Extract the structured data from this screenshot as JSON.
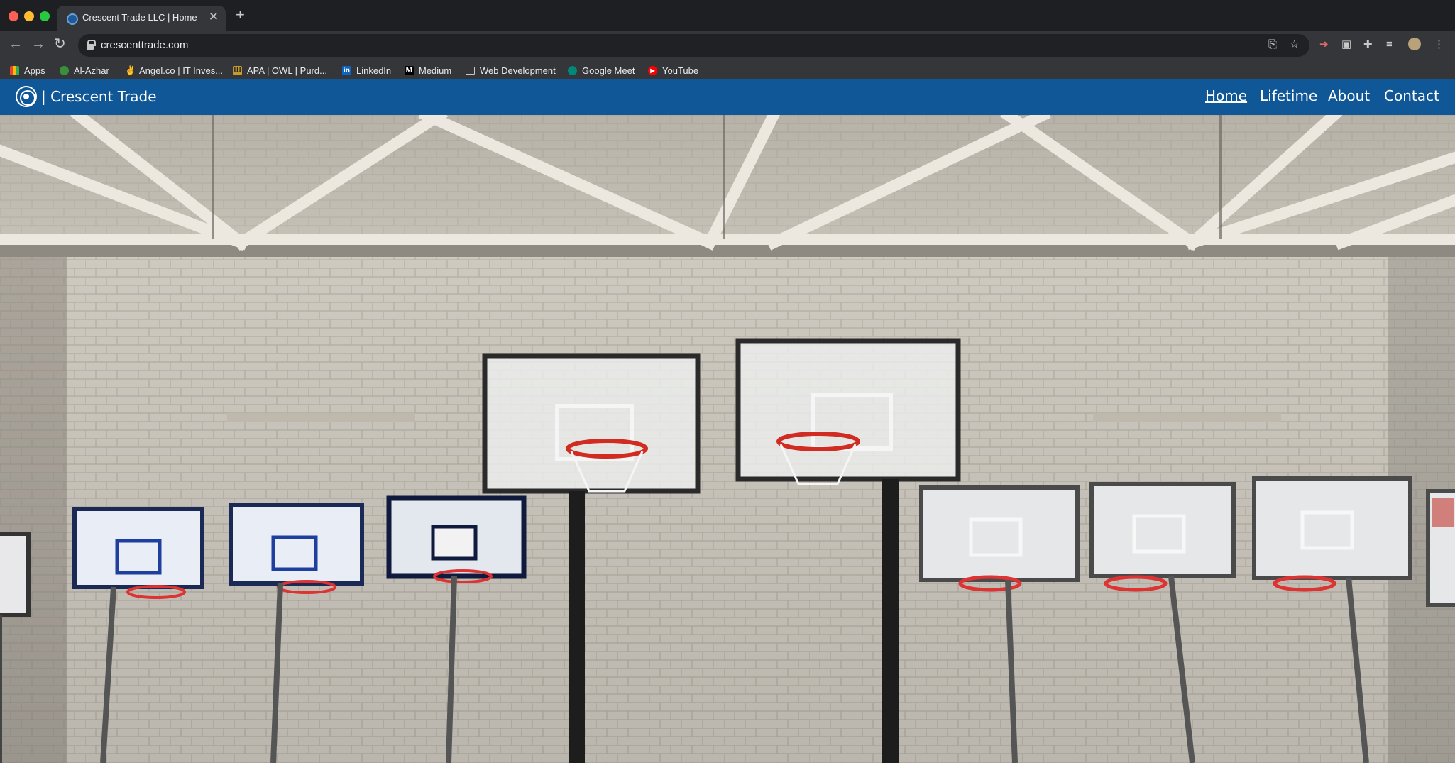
{
  "browser": {
    "tab_title": "Crescent Trade LLC | Home",
    "tab_close": "✕",
    "new_tab": "+",
    "url": "crescenttrade.com"
  },
  "bookmarks": [
    {
      "label": "Apps",
      "icon": "apps-grid-icon"
    },
    {
      "label": "Al-Azhar",
      "icon": "al-azhar-icon"
    },
    {
      "label": "Angel.co | IT Inves...",
      "icon": "angel-icon"
    },
    {
      "label": "APA | OWL | Purd...",
      "icon": "owl-icon"
    },
    {
      "label": "LinkedIn",
      "icon": "linkedin-icon"
    },
    {
      "label": "Medium",
      "icon": "medium-icon"
    },
    {
      "label": "Web Development",
      "icon": "folder-icon"
    },
    {
      "label": "Google Meet",
      "icon": "google-meet-icon"
    },
    {
      "label": "YouTube",
      "icon": "youtube-icon"
    }
  ],
  "site": {
    "brand": "| Crescent Trade",
    "nav": [
      {
        "label": "Home",
        "active": true
      },
      {
        "label": "Lifetime",
        "active": false
      },
      {
        "label": "About",
        "active": false
      },
      {
        "label": "Contact",
        "active": false
      }
    ],
    "hero_image": "indoor gym with basketball hoops against a brick wall"
  },
  "colors": {
    "nav_blue": "#0f5797",
    "chrome_dark": "#35363a",
    "titlebar": "#1e1f22"
  }
}
